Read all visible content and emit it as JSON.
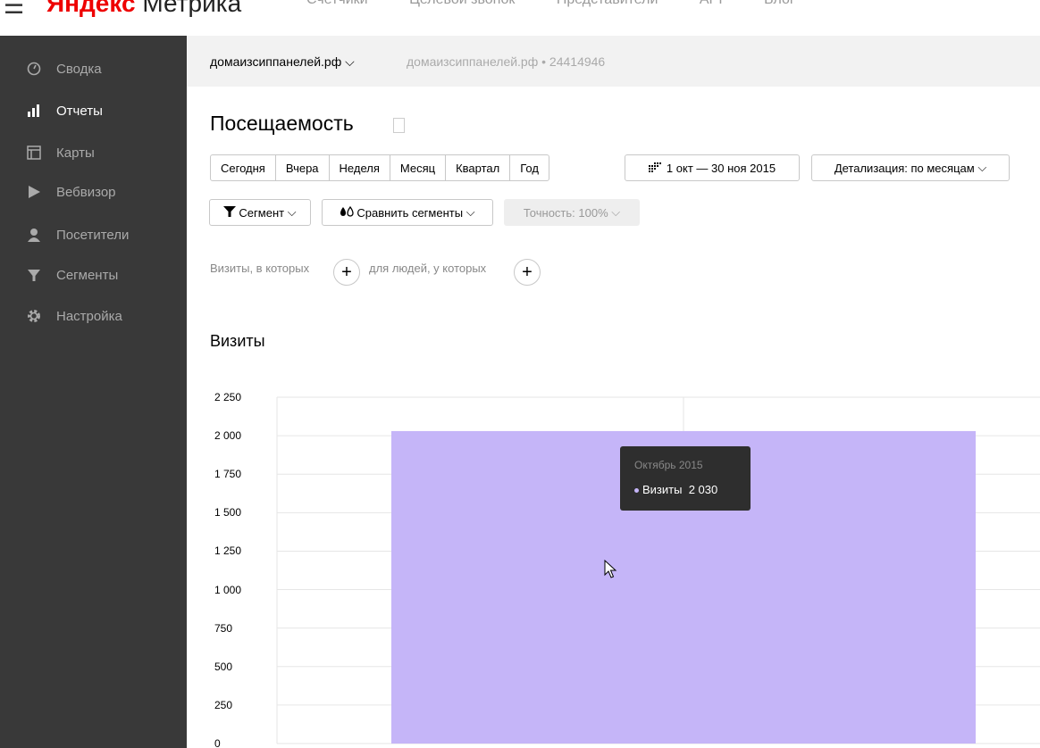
{
  "header": {
    "brand_yandex": "Яндекс",
    "brand_product": "Метрика",
    "nav": [
      "Счетчики",
      "Целевой звонок",
      "Представители",
      "API",
      "Блог"
    ]
  },
  "sidebar": {
    "items": [
      {
        "label": "Сводка",
        "icon": "dashboard-icon"
      },
      {
        "label": "Отчеты",
        "icon": "bar-chart-icon",
        "active": true
      },
      {
        "label": "Карты",
        "icon": "map-icon"
      },
      {
        "label": "Вебвизор",
        "icon": "play-icon"
      },
      {
        "label": "Посетители",
        "icon": "user-icon"
      },
      {
        "label": "Сегменты",
        "icon": "filter-icon"
      },
      {
        "label": "Настройка",
        "icon": "gear-icon"
      }
    ]
  },
  "sitebar": {
    "site": "домаизсиппанелей.рф",
    "site_info": "домаизсиппанелей.рф • 24414946"
  },
  "page": {
    "title": "Посещаемость",
    "periods": [
      "Сегодня",
      "Вчера",
      "Неделя",
      "Месяц",
      "Квартал",
      "Год"
    ],
    "date_range": "1 окт — 30 ноя 2015",
    "detail": "Детализация: по месяцам",
    "segment": "Сегмент",
    "compare": "Сравнить сегменты",
    "accuracy": "Точность: 100%",
    "filter_visits": "Визиты, в которых",
    "filter_people": "для людей, у которых"
  },
  "chart_data": {
    "type": "bar",
    "title": "Визиты",
    "categories": [
      "Октябрь 2015"
    ],
    "values": [
      2030
    ],
    "ylim": [
      0,
      2250
    ],
    "yticks": [
      "0",
      "250",
      "500",
      "750",
      "1 000",
      "1 250",
      "1 500",
      "1 750",
      "2 000",
      "2 250"
    ],
    "ytick_values": [
      0,
      250,
      500,
      750,
      1000,
      1250,
      1500,
      1750,
      2000,
      2250
    ],
    "bar_color": "#c5b5f8",
    "grid": true
  },
  "tooltip": {
    "date": "Октябрь 2015",
    "series": "Визиты",
    "value": "2 030"
  },
  "colors": {
    "sidebar_bg": "#393939",
    "brand_red": "#e00000"
  }
}
